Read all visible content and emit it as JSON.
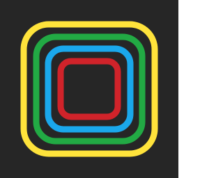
{
  "icon": {
    "name": "concentric-rounded-squares-icon",
    "colors": {
      "background": "#262626",
      "outer_ring": "#FFE33B",
      "second_ring": "#22AA44",
      "third_ring": "#1AA8EC",
      "inner_ring": "#D0232A"
    }
  }
}
